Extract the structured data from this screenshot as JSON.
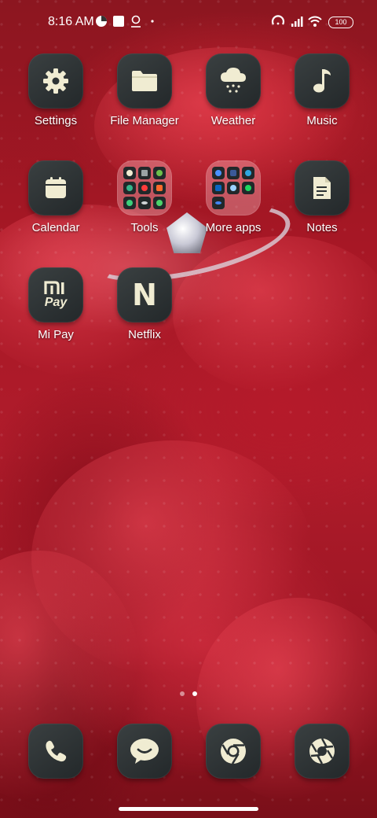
{
  "status_bar": {
    "time": "8:16 AM",
    "battery": "100"
  },
  "apps": [
    {
      "label": "Settings",
      "icon": "gear-icon"
    },
    {
      "label": "File Manager",
      "icon": "folder-icon"
    },
    {
      "label": "Weather",
      "icon": "cloud-snow-icon"
    },
    {
      "label": "Music",
      "icon": "music-note-icon"
    },
    {
      "label": "Calendar",
      "icon": "calendar-icon"
    },
    {
      "label": "Tools",
      "icon": "folder-tools"
    },
    {
      "label": "More apps",
      "icon": "folder-more-apps"
    },
    {
      "label": "Notes",
      "icon": "notes-icon"
    },
    {
      "label": "Mi Pay",
      "icon": "mi-pay-icon",
      "tile_text": "Pay"
    },
    {
      "label": "Netflix",
      "icon": "netflix-icon",
      "tile_text": "N"
    }
  ],
  "folder_tools_apps": [
    "contacts",
    "apps-grid",
    "browser",
    "security",
    "recorder",
    "screen-recorder",
    "compass",
    "infinity",
    "mint-browser"
  ],
  "folder_more_apps_apps": [
    "tasks",
    "facebook",
    "microsoft-edge",
    "linkedin",
    "photos",
    "spotify",
    "lens"
  ],
  "dock": [
    {
      "name": "phone",
      "icon": "phone-icon"
    },
    {
      "name": "messaging",
      "icon": "chat-bubble-icon"
    },
    {
      "name": "chrome",
      "icon": "chrome-icon"
    },
    {
      "name": "camera",
      "icon": "camera-aperture-icon"
    }
  ],
  "page_indicator": {
    "pages": 2,
    "current": 2
  },
  "colors": {
    "tile": "#2c3234",
    "glyph": "#f0ecd2",
    "label": "#ffffff"
  }
}
